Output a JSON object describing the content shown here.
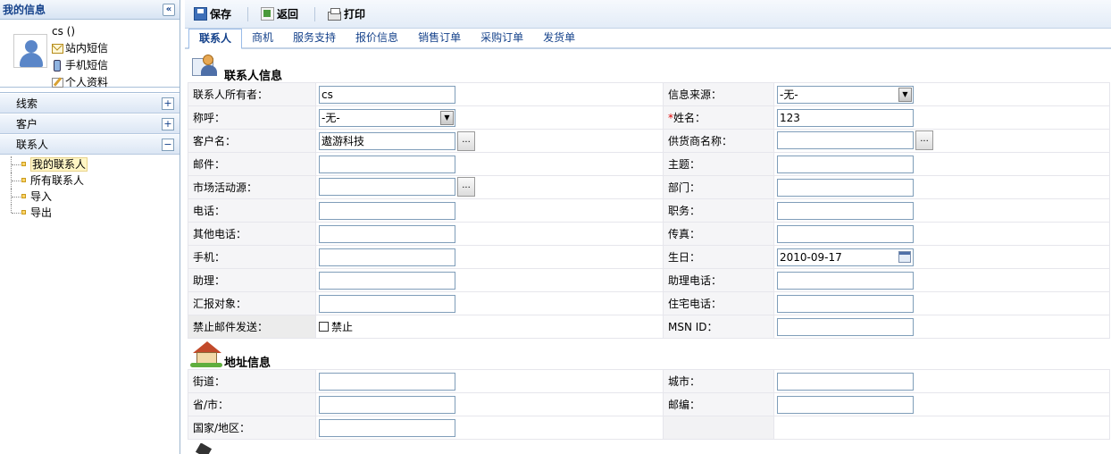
{
  "sidebar": {
    "myinfo": {
      "title": "我的信息",
      "collapse_icon": "«",
      "username": "cs ()",
      "links": [
        "站内短信",
        "手机短信",
        "个人资料"
      ]
    },
    "nav": [
      {
        "label": "线索",
        "toggle": "+"
      },
      {
        "label": "客户",
        "toggle": "+"
      },
      {
        "label": "联系人",
        "toggle": "−"
      }
    ],
    "tree": [
      "我的联系人",
      "所有联系人",
      "导入",
      "导出"
    ]
  },
  "toolbar": {
    "save": "保存",
    "back": "返回",
    "print": "打印"
  },
  "tabs": [
    "联系人",
    "商机",
    "服务支持",
    "报价信息",
    "销售订单",
    "采购订单",
    "发货单"
  ],
  "contact_section": {
    "title": "联系人信息",
    "rows": [
      {
        "l1": "联系人所有者：",
        "v1": "cs",
        "l2": "信息来源：",
        "v2": "-无-"
      },
      {
        "l1": "称呼：",
        "v1": "-无-",
        "l2": "姓名：",
        "l2_req": "*",
        "v2": "123"
      },
      {
        "l1": "客户名：",
        "v1": "遨游科技",
        "l2": "供货商名称：",
        "v2": ""
      },
      {
        "l1": "邮件：",
        "v1": "",
        "l2": "主题：",
        "v2": ""
      },
      {
        "l1": "市场活动源：",
        "v1": "",
        "l2": "部门：",
        "v2": ""
      },
      {
        "l1": "电话：",
        "v1": "",
        "l2": "职务：",
        "v2": ""
      },
      {
        "l1": "其他电话：",
        "v1": "",
        "l2": "传真：",
        "v2": ""
      },
      {
        "l1": "手机：",
        "v1": "",
        "l2": "生日：",
        "v2": "2010-09-17"
      },
      {
        "l1": "助理：",
        "v1": "",
        "l2": "助理电话：",
        "v2": ""
      },
      {
        "l1": "汇报对象：",
        "v1": "",
        "l2": "住宅电话：",
        "v2": ""
      },
      {
        "l1": "禁止邮件发送：",
        "v1": "禁止",
        "l2": "MSN ID：",
        "v2": ""
      }
    ],
    "lookup_button": "..."
  },
  "address_section": {
    "title": "地址信息",
    "rows": [
      {
        "l1": "街道：",
        "v1": "",
        "l2": "城市：",
        "v2": ""
      },
      {
        "l1": "省/市：",
        "v1": "",
        "l2": "邮编：",
        "v2": ""
      },
      {
        "l1": "国家/地区：",
        "v1": ""
      }
    ]
  },
  "icons": {
    "save": "save-icon",
    "back": "back-icon",
    "print": "print-icon",
    "contact_section": "contact-card-icon",
    "address_section": "house-icon",
    "calendar": "calendar-icon",
    "mail": "mail-icon",
    "phone": "phone-icon",
    "profile": "edit-icon"
  }
}
